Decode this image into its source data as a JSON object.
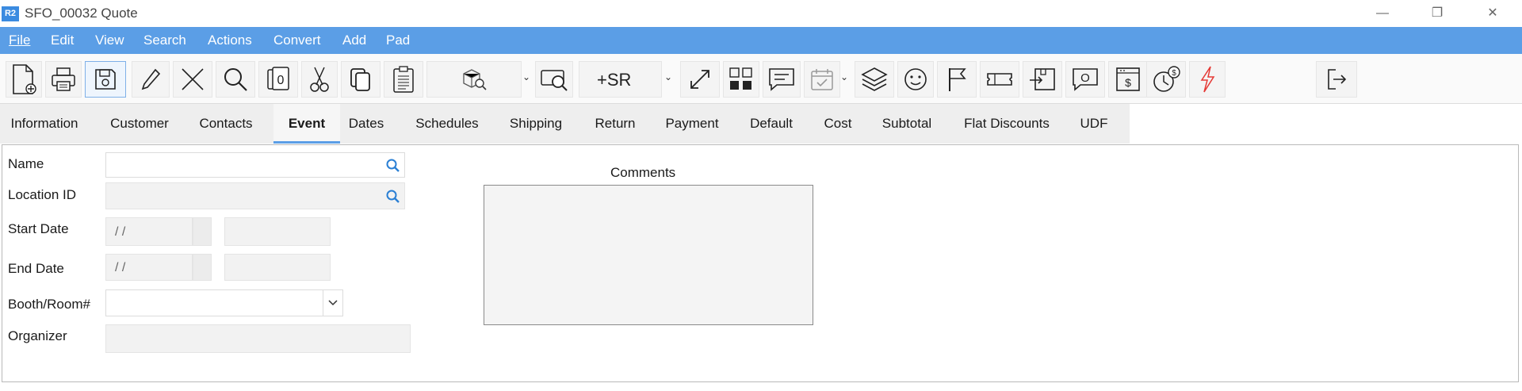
{
  "window": {
    "logo": "R2",
    "title": "SFO_00032 Quote",
    "minimize_icon": "—",
    "restore_icon": "❐",
    "close_icon": "✕"
  },
  "menu": [
    "File",
    "Edit",
    "View",
    "Search",
    "Actions",
    "Convert",
    "Add",
    "Pad"
  ],
  "toolbar": {
    "sr_label": "+SR",
    "icons": [
      "new-document-icon",
      "print-icon",
      "save-icon",
      "edit-pencil-icon",
      "delete-x-icon",
      "search-icon",
      "copy-zero-icon",
      "cut-scissors-icon",
      "copy-icon",
      "paste-icon",
      "box-search-icon",
      "preview-search-icon",
      "add-sr-icon",
      "expand-icon",
      "grid-icon",
      "chat-icon",
      "calendar-check-icon",
      "layers-icon",
      "smiley-icon",
      "flag-icon",
      "ticket-icon",
      "box-arrow-icon",
      "chat-o-icon",
      "invoice-icon",
      "clock-dollar-icon",
      "lightning-icon",
      "exit-icon"
    ]
  },
  "tabs": [
    "Information",
    "Customer",
    "Contacts",
    "Event",
    "Dates",
    "Schedules",
    "Shipping",
    "Return",
    "Payment",
    "Default",
    "Cost",
    "Subtotal",
    "Flat Discounts",
    "UDF"
  ],
  "active_tab": "Event",
  "form": {
    "name_label": "Name",
    "location_label": "Location ID",
    "start_date_label": "Start Date",
    "start_date_value": "/ /",
    "end_date_label": "End Date",
    "end_date_value": "/ /",
    "booth_label": "Booth/Room#",
    "organizer_label": "Organizer",
    "comments_label": "Comments"
  },
  "colors": {
    "accent": "#5b9ee6",
    "search_icon": "#2a7fd4",
    "lightning": "#e53935"
  }
}
